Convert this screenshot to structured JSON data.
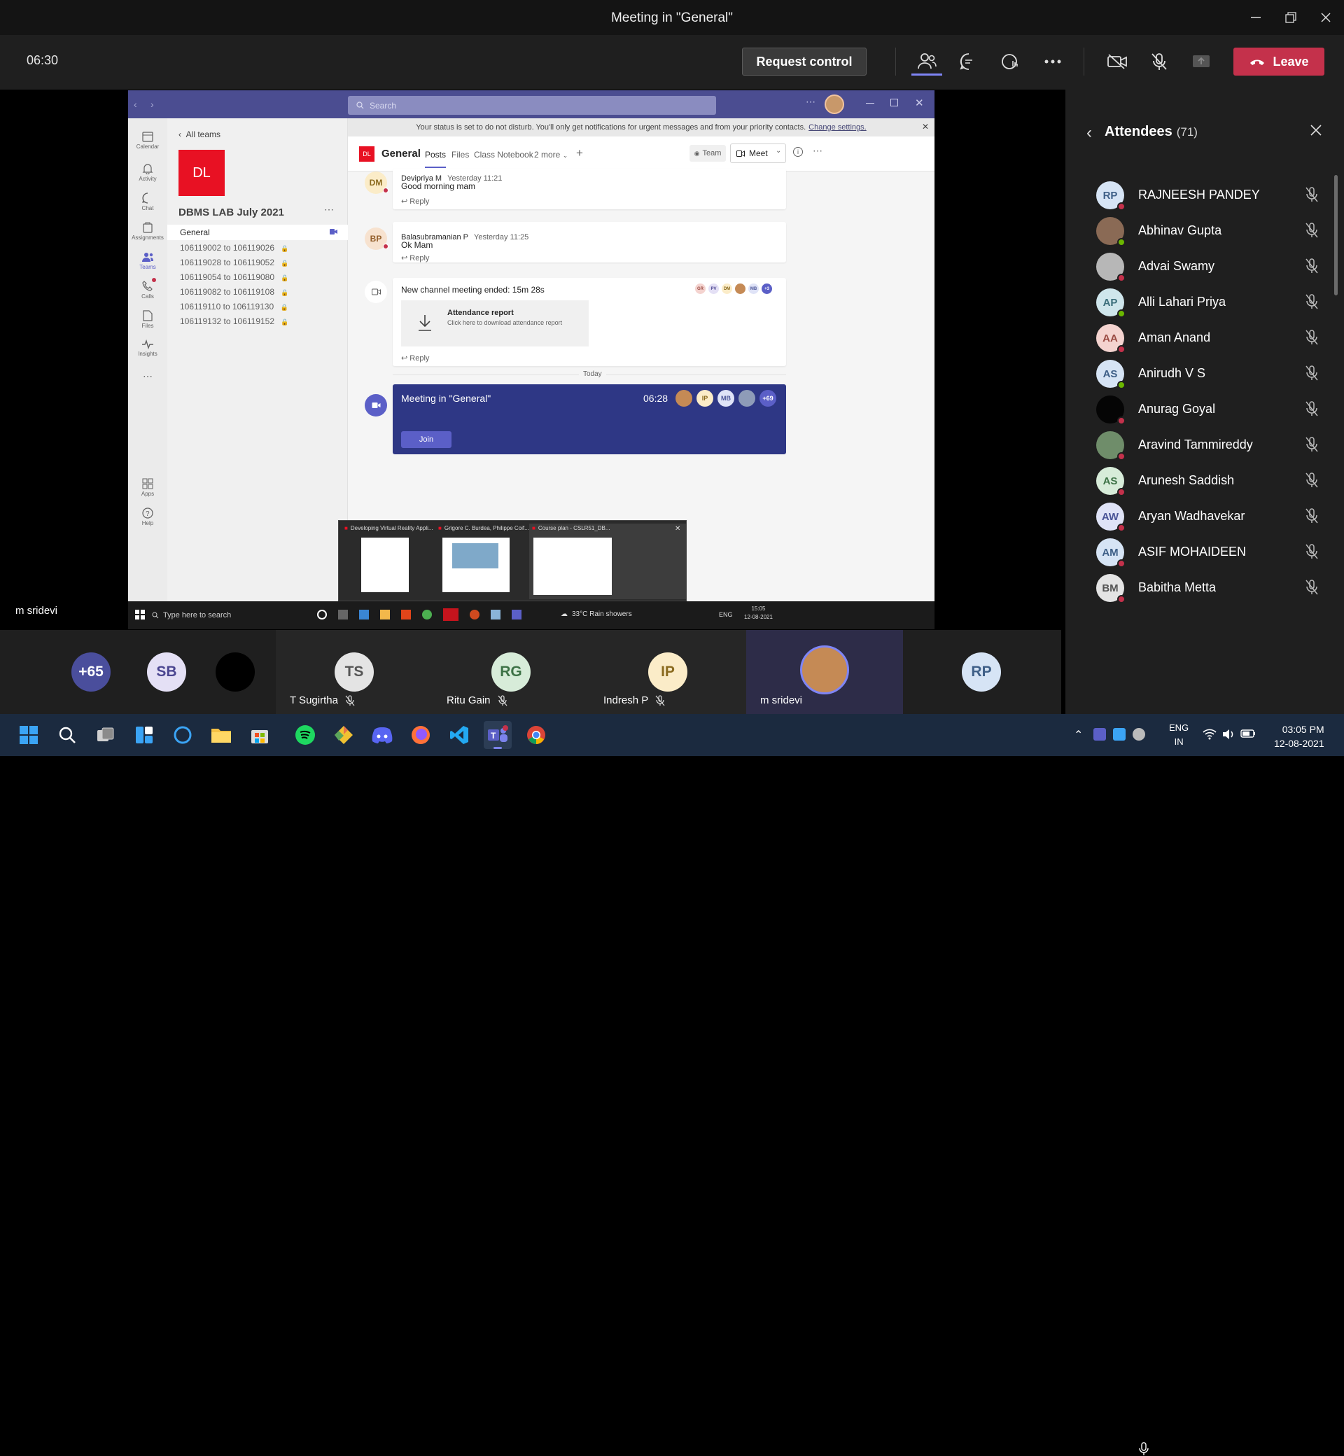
{
  "window": {
    "title": "Meeting in \"General\""
  },
  "toolbar": {
    "timer": "06:30",
    "request_control": "Request control",
    "leave": "Leave"
  },
  "presenter": {
    "name": "m sridevi"
  },
  "shared_screen": {
    "search_placeholder": "Search",
    "all_teams": "All teams",
    "team_initials": "DL",
    "team_name": "DBMS LAB July 2021",
    "channels": [
      "General",
      "106119002 to 106119026",
      "106119028 to 106119052",
      "106119054 to 106119080",
      "106119082 to 106119108",
      "106119110 to 106119130",
      "106119132 to 106119152"
    ],
    "rail": [
      "Calendar",
      "Activity",
      "Chat",
      "Assignments",
      "Teams",
      "Calls",
      "Files",
      "Insights",
      "Apps",
      "Help"
    ],
    "dnd_text": "Your status is set to do not disturb. You'll only get notifications for urgent messages and from your priority contacts.",
    "dnd_link": "Change settings.",
    "channel": {
      "initials": "DL",
      "name": "General",
      "tabs": [
        "Posts",
        "Files",
        "Class Notebook",
        "2 more"
      ],
      "team_btn": "Team",
      "meet_btn": "Meet"
    },
    "posts": [
      {
        "initials": "DM",
        "author": "Devipriya M",
        "time": "Yesterday 11:21",
        "text": "Good morning mam",
        "reply": "Reply"
      },
      {
        "initials": "BP",
        "author": "Balasubramanian P",
        "time": "Yesterday 11:25",
        "text": "Ok Mam",
        "reply": "Reply"
      }
    ],
    "meeting_ended": {
      "text": "New channel meeting ended: 15m 28s",
      "chips": [
        "GR",
        "PV",
        "DM",
        "",
        "MB",
        "+3"
      ],
      "report_title": "Attendance report",
      "report_sub": "Click here to download attendance report",
      "reply": "Reply"
    },
    "today": "Today",
    "live_meeting": {
      "title": "Meeting in \"General\"",
      "time": "06:28",
      "chips": [
        "",
        "IP",
        "MB",
        "",
        "+69"
      ],
      "join": "Join"
    },
    "thumbnails": [
      "Developing Virtual Reality Appli...",
      "Grigore C. Burdea, Philippe Coif...",
      "Course plan - CSLR51_DB..."
    ],
    "taskbar": {
      "search": "Type here to search",
      "weather": "33°C  Rain showers",
      "lang": "ENG",
      "time": "15:05",
      "date": "12-08-2021"
    }
  },
  "attendees": {
    "title": "Attendees",
    "count": "(71)",
    "list": [
      {
        "initials": "RP",
        "name": "RAJNEESH PANDEY",
        "bg": "#d6e4f5",
        "fg": "#3e5f87",
        "status": "#c4314b"
      },
      {
        "initials": "",
        "name": "Abhinav Gupta",
        "bg": "#8a6a55",
        "fg": "#fff",
        "status": "#6bb700"
      },
      {
        "initials": "",
        "name": "Advai Swamy",
        "bg": "#b7b7b7",
        "fg": "#fff",
        "status": "#c4314b"
      },
      {
        "initials": "AP",
        "name": "Alli Lahari Priya",
        "bg": "#cfe6ec",
        "fg": "#3b6e7b",
        "status": "#6bb700"
      },
      {
        "initials": "AA",
        "name": "Aman Anand",
        "bg": "#f4d3cf",
        "fg": "#9a4b43",
        "status": "#c4314b"
      },
      {
        "initials": "AS",
        "name": "Anirudh V S",
        "bg": "#d6e4f5",
        "fg": "#3e5f87",
        "status": "#6bb700"
      },
      {
        "initials": "",
        "name": "Anurag Goyal",
        "bg": "#050505",
        "fg": "#fff",
        "status": "#c4314b"
      },
      {
        "initials": "",
        "name": "Aravind Tammireddy",
        "bg": "#6f8d6a",
        "fg": "#fff",
        "status": "#c4314b"
      },
      {
        "initials": "AS",
        "name": "Arunesh Saddish",
        "bg": "#d7ecd9",
        "fg": "#3d7246",
        "status": "#c4314b"
      },
      {
        "initials": "AW",
        "name": "Aryan Wadhavekar",
        "bg": "#dfe3f7",
        "fg": "#4a5497",
        "status": "#c4314b"
      },
      {
        "initials": "AM",
        "name": "ASIF MOHAIDEEN",
        "bg": "#d6e4f5",
        "fg": "#3e5f87",
        "status": "#c4314b"
      },
      {
        "initials": "BM",
        "name": "Babitha Metta",
        "bg": "#e4e4e4",
        "fg": "#555",
        "status": "#c4314b"
      }
    ]
  },
  "participants": [
    {
      "initials": "+65",
      "name": "",
      "bg": "#4a4e9c",
      "fg": "#fff"
    },
    {
      "initials": "SB",
      "name": "",
      "bg": "#e4e0f5",
      "fg": "#4a4590"
    },
    {
      "initials": "",
      "name": "",
      "bg": "#000000",
      "fg": "#fff"
    },
    {
      "initials": "TS",
      "name": "T Sugirtha",
      "bg": "#e4e4e4",
      "fg": "#555"
    },
    {
      "initials": "RG",
      "name": "Ritu Gain",
      "bg": "#d7ecd9",
      "fg": "#3d7246"
    },
    {
      "initials": "IP",
      "name": "Indresh P",
      "bg": "#fbecc8",
      "fg": "#8a6a1e"
    },
    {
      "initials": "",
      "name": "m sridevi",
      "bg": "#c58a55",
      "fg": "#fff"
    },
    {
      "initials": "RP",
      "name": "",
      "bg": "#d6e4f5",
      "fg": "#3e5f87"
    }
  ],
  "win_taskbar": {
    "lang1": "ENG",
    "lang2": "IN",
    "time": "03:05 PM",
    "date": "12-08-2021"
  },
  "colors": {
    "teams_purple": "#4b4d91",
    "leave_red": "#c4314b",
    "meeting_card": "#2e3785"
  }
}
